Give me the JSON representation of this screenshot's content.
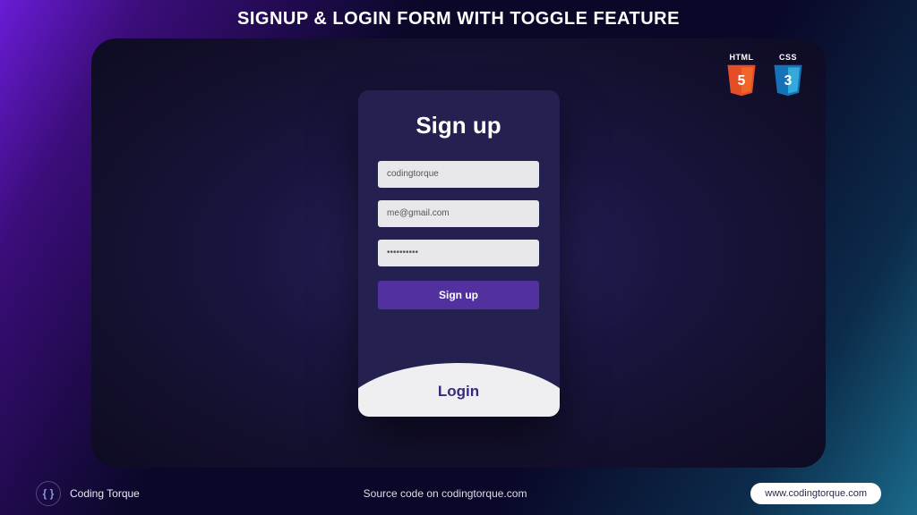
{
  "page_title": "SIGNUP & LOGIN FORM WITH TOGGLE FEATURE",
  "badges": {
    "html": "HTML",
    "html_num": "5",
    "css": "CSS",
    "css_num": "3"
  },
  "card": {
    "title": "Sign up",
    "username_value": "codingtorque",
    "email_value": "me@gmail.com",
    "password_value": "••••••••••",
    "submit_label": "Sign up",
    "toggle_label": "Login"
  },
  "footer": {
    "brand_icon": "{ }",
    "brand_name": "Coding Torque",
    "center_text": "Source code on codingtorque.com",
    "site_pill": "www.codingtorque.com"
  }
}
